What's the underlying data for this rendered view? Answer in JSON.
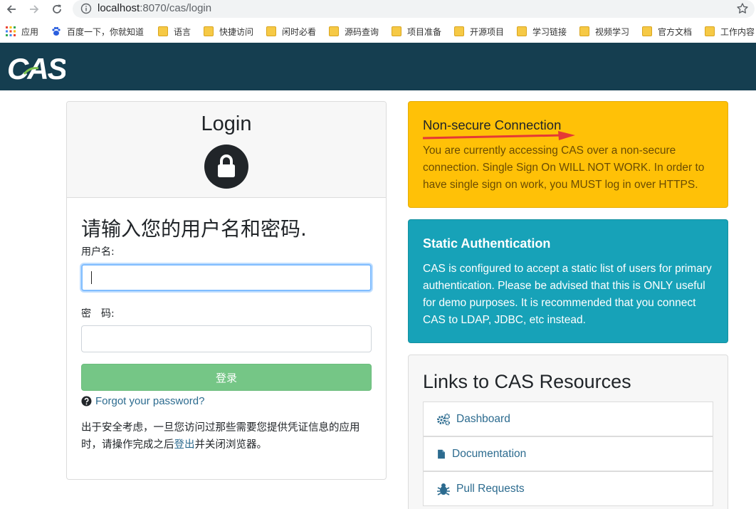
{
  "browser": {
    "url_host": "localhost",
    "url_rest": ":8070/cas/login",
    "icons": [
      "back-icon",
      "forward-icon",
      "reload-icon",
      "info-icon",
      "star-icon"
    ],
    "bookmarks": [
      {
        "label": "应用",
        "icon": "apps-icon"
      },
      {
        "label": "百度一下，你就知道",
        "icon": "baidu-icon"
      },
      {
        "label": "语言",
        "icon": "folder-icon"
      },
      {
        "label": "快捷访问",
        "icon": "folder-icon"
      },
      {
        "label": "闲时必看",
        "icon": "folder-icon"
      },
      {
        "label": "源码查询",
        "icon": "folder-icon"
      },
      {
        "label": "项目准备",
        "icon": "folder-icon"
      },
      {
        "label": "开源项目",
        "icon": "folder-icon"
      },
      {
        "label": "学习链接",
        "icon": "folder-icon"
      },
      {
        "label": "视频学习",
        "icon": "folder-icon"
      },
      {
        "label": "官方文档",
        "icon": "folder-icon"
      },
      {
        "label": "工作内容",
        "icon": "folder-icon"
      }
    ]
  },
  "header": {
    "logo_text": "CAS",
    "bg_color": "#153e50"
  },
  "login": {
    "title": "Login",
    "prompt": "请输入您的用户名和密码.",
    "username_label": "用户名:",
    "username_value": "",
    "password_label": "密　码:",
    "password_value": "",
    "submit_label": "登录",
    "forgot_label": "Forgot your password?",
    "notice_before": "出于安全考虑，一旦您访问过那些需要您提供凭证信息的应用时，请操作完成之后",
    "notice_link": "登出",
    "notice_after": "并关闭浏览器。",
    "submit_color": "#75c686"
  },
  "warning": {
    "title": "Non-secure Connection",
    "body": "You are currently accessing CAS over a non-secure connection. Single Sign On WILL NOT WORK. In order to have single sign on work, you MUST log in over HTTPS.",
    "color": "#ffc107"
  },
  "static_auth": {
    "title": "Static Authentication",
    "body": "CAS is configured to accept a static list of users for primary authentication. Please be advised that this is ONLY useful for demo purposes. It is recommended that you connect CAS to LDAP, JDBC, etc instead.",
    "color": "#17a2b8"
  },
  "resources": {
    "title": "Links to CAS Resources",
    "links": [
      {
        "label": "Dashboard",
        "icon": "gears-icon"
      },
      {
        "label": "Documentation",
        "icon": "file-icon"
      },
      {
        "label": "Pull Requests",
        "icon": "bug-icon"
      }
    ]
  }
}
